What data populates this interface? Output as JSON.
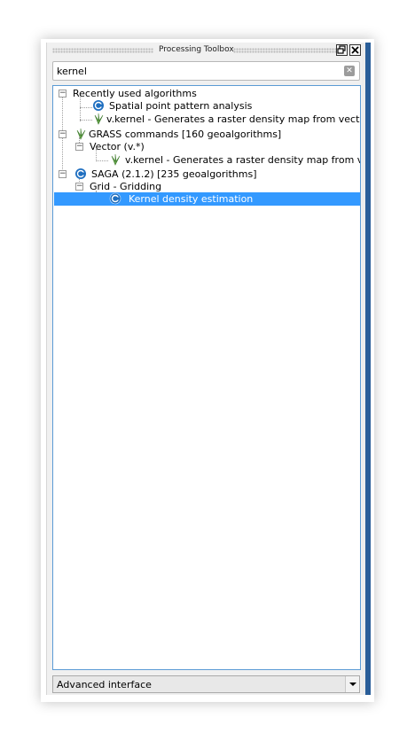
{
  "window": {
    "title": "Processing Toolbox"
  },
  "titlebar_buttons": {
    "float_icon": "restore-icon",
    "close_icon": "close-icon"
  },
  "search": {
    "value": "kernel",
    "clear_icon": "clear-icon"
  },
  "tree": {
    "recent": {
      "label": "Recently used algorithms",
      "items": [
        {
          "label": "Spatial point pattern analysis",
          "icon": "saga-icon"
        },
        {
          "label": "v.kernel - Generates a raster density map from vector p...",
          "icon": "grass-icon"
        }
      ]
    },
    "grass": {
      "label": "GRASS commands [160 geoalgorithms]",
      "icon": "grass-icon",
      "group": "Vector (v.*)",
      "items": [
        {
          "label": "v.kernel - Generates a raster density map from vect...",
          "icon": "grass-icon"
        }
      ]
    },
    "saga": {
      "label": "SAGA (2.1.2) [235 geoalgorithms]",
      "icon": "saga-icon",
      "group": "Grid - Gridding",
      "items": [
        {
          "label": "Kernel density estimation",
          "icon": "saga-icon",
          "selected": true
        }
      ]
    }
  },
  "interface_select": {
    "value": "Advanced interface"
  },
  "colors": {
    "selection": "#3399ff",
    "accent": "#2a5e99",
    "tree_border": "#5b9bd5"
  }
}
